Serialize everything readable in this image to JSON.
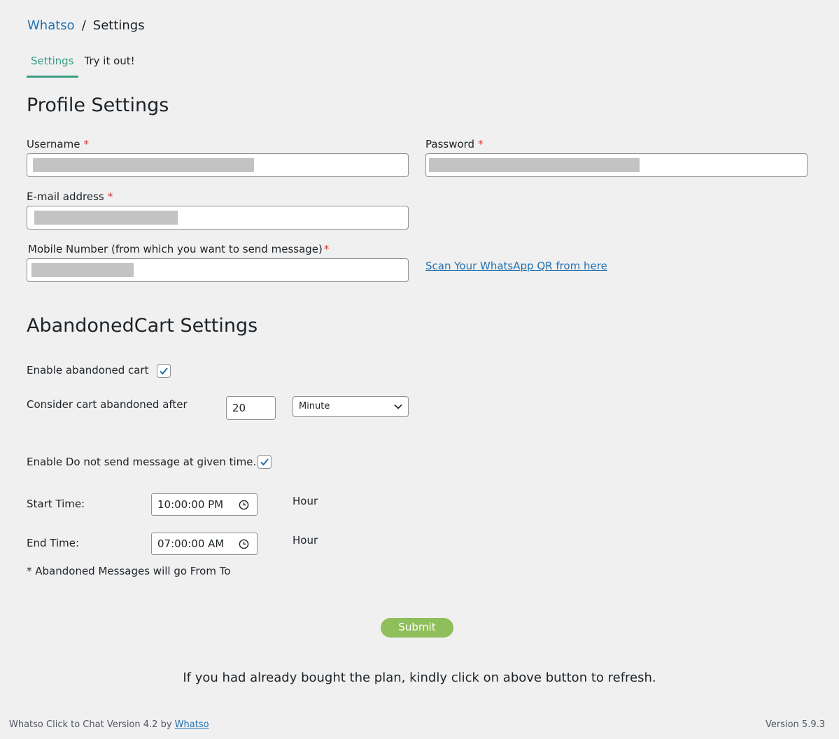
{
  "breadcrumb": {
    "root": "Whatso",
    "separator": "/",
    "current": "Settings"
  },
  "tabs": [
    {
      "label": "Settings",
      "active": true
    },
    {
      "label": "Try it out!",
      "active": false
    }
  ],
  "profile": {
    "heading": "Profile Settings",
    "username_label": "Username",
    "password_label": "Password",
    "email_label": "E-mail address",
    "mobile_label": "Mobile Number (from which you want to send message)",
    "required_mark": "*",
    "qr_link": "Scan Your WhatsApp QR from here"
  },
  "cart": {
    "heading": "AbandonedCart Settings",
    "enable_label": "Enable abandoned cart",
    "enable_checked": true,
    "consider_label": "Consider cart abandoned after",
    "consider_value": "20",
    "unit_selected": "Minute",
    "dnd_label": "Enable Do not send message at given time.",
    "dnd_checked": true,
    "start_label": "Start Time:",
    "start_value": "10:00:00 PM",
    "end_label": "End Time:",
    "end_value": "07:00:00 AM",
    "hour_label": "Hour",
    "note": "* Abandoned Messages will go From To"
  },
  "actions": {
    "submit_label": "Submit"
  },
  "refresh_note": "If you had already bought the plan, kindly click on above button to refresh.",
  "footer": {
    "left_text": "Whatso Click to Chat Version 4.2 by",
    "left_link": "Whatso",
    "version": "Version 5.9.3"
  },
  "colors": {
    "accent": "#3a9e83",
    "link": "#2271b1",
    "submit": "#8fbf5a",
    "required": "#d63638"
  }
}
